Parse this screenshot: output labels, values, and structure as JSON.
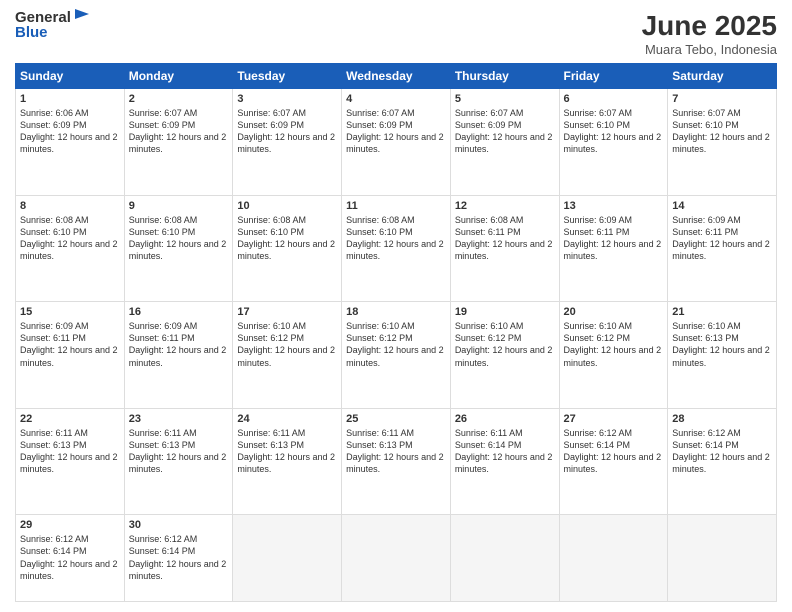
{
  "logo": {
    "general": "General",
    "blue": "Blue"
  },
  "header": {
    "month": "June 2025",
    "location": "Muara Tebo, Indonesia"
  },
  "weekdays": [
    "Sunday",
    "Monday",
    "Tuesday",
    "Wednesday",
    "Thursday",
    "Friday",
    "Saturday"
  ],
  "weeks": [
    [
      {
        "day": "1",
        "sunrise": "6:06 AM",
        "sunset": "6:09 PM",
        "daylight": "12 hours and 2 minutes."
      },
      {
        "day": "2",
        "sunrise": "6:07 AM",
        "sunset": "6:09 PM",
        "daylight": "12 hours and 2 minutes."
      },
      {
        "day": "3",
        "sunrise": "6:07 AM",
        "sunset": "6:09 PM",
        "daylight": "12 hours and 2 minutes."
      },
      {
        "day": "4",
        "sunrise": "6:07 AM",
        "sunset": "6:09 PM",
        "daylight": "12 hours and 2 minutes."
      },
      {
        "day": "5",
        "sunrise": "6:07 AM",
        "sunset": "6:09 PM",
        "daylight": "12 hours and 2 minutes."
      },
      {
        "day": "6",
        "sunrise": "6:07 AM",
        "sunset": "6:10 PM",
        "daylight": "12 hours and 2 minutes."
      },
      {
        "day": "7",
        "sunrise": "6:07 AM",
        "sunset": "6:10 PM",
        "daylight": "12 hours and 2 minutes."
      }
    ],
    [
      {
        "day": "8",
        "sunrise": "6:08 AM",
        "sunset": "6:10 PM",
        "daylight": "12 hours and 2 minutes."
      },
      {
        "day": "9",
        "sunrise": "6:08 AM",
        "sunset": "6:10 PM",
        "daylight": "12 hours and 2 minutes."
      },
      {
        "day": "10",
        "sunrise": "6:08 AM",
        "sunset": "6:10 PM",
        "daylight": "12 hours and 2 minutes."
      },
      {
        "day": "11",
        "sunrise": "6:08 AM",
        "sunset": "6:10 PM",
        "daylight": "12 hours and 2 minutes."
      },
      {
        "day": "12",
        "sunrise": "6:08 AM",
        "sunset": "6:11 PM",
        "daylight": "12 hours and 2 minutes."
      },
      {
        "day": "13",
        "sunrise": "6:09 AM",
        "sunset": "6:11 PM",
        "daylight": "12 hours and 2 minutes."
      },
      {
        "day": "14",
        "sunrise": "6:09 AM",
        "sunset": "6:11 PM",
        "daylight": "12 hours and 2 minutes."
      }
    ],
    [
      {
        "day": "15",
        "sunrise": "6:09 AM",
        "sunset": "6:11 PM",
        "daylight": "12 hours and 2 minutes."
      },
      {
        "day": "16",
        "sunrise": "6:09 AM",
        "sunset": "6:11 PM",
        "daylight": "12 hours and 2 minutes."
      },
      {
        "day": "17",
        "sunrise": "6:10 AM",
        "sunset": "6:12 PM",
        "daylight": "12 hours and 2 minutes."
      },
      {
        "day": "18",
        "sunrise": "6:10 AM",
        "sunset": "6:12 PM",
        "daylight": "12 hours and 2 minutes."
      },
      {
        "day": "19",
        "sunrise": "6:10 AM",
        "sunset": "6:12 PM",
        "daylight": "12 hours and 2 minutes."
      },
      {
        "day": "20",
        "sunrise": "6:10 AM",
        "sunset": "6:12 PM",
        "daylight": "12 hours and 2 minutes."
      },
      {
        "day": "21",
        "sunrise": "6:10 AM",
        "sunset": "6:13 PM",
        "daylight": "12 hours and 2 minutes."
      }
    ],
    [
      {
        "day": "22",
        "sunrise": "6:11 AM",
        "sunset": "6:13 PM",
        "daylight": "12 hours and 2 minutes."
      },
      {
        "day": "23",
        "sunrise": "6:11 AM",
        "sunset": "6:13 PM",
        "daylight": "12 hours and 2 minutes."
      },
      {
        "day": "24",
        "sunrise": "6:11 AM",
        "sunset": "6:13 PM",
        "daylight": "12 hours and 2 minutes."
      },
      {
        "day": "25",
        "sunrise": "6:11 AM",
        "sunset": "6:13 PM",
        "daylight": "12 hours and 2 minutes."
      },
      {
        "day": "26",
        "sunrise": "6:11 AM",
        "sunset": "6:14 PM",
        "daylight": "12 hours and 2 minutes."
      },
      {
        "day": "27",
        "sunrise": "6:12 AM",
        "sunset": "6:14 PM",
        "daylight": "12 hours and 2 minutes."
      },
      {
        "day": "28",
        "sunrise": "6:12 AM",
        "sunset": "6:14 PM",
        "daylight": "12 hours and 2 minutes."
      }
    ],
    [
      {
        "day": "29",
        "sunrise": "6:12 AM",
        "sunset": "6:14 PM",
        "daylight": "12 hours and 2 minutes."
      },
      {
        "day": "30",
        "sunrise": "6:12 AM",
        "sunset": "6:14 PM",
        "daylight": "12 hours and 2 minutes."
      },
      null,
      null,
      null,
      null,
      null
    ]
  ]
}
